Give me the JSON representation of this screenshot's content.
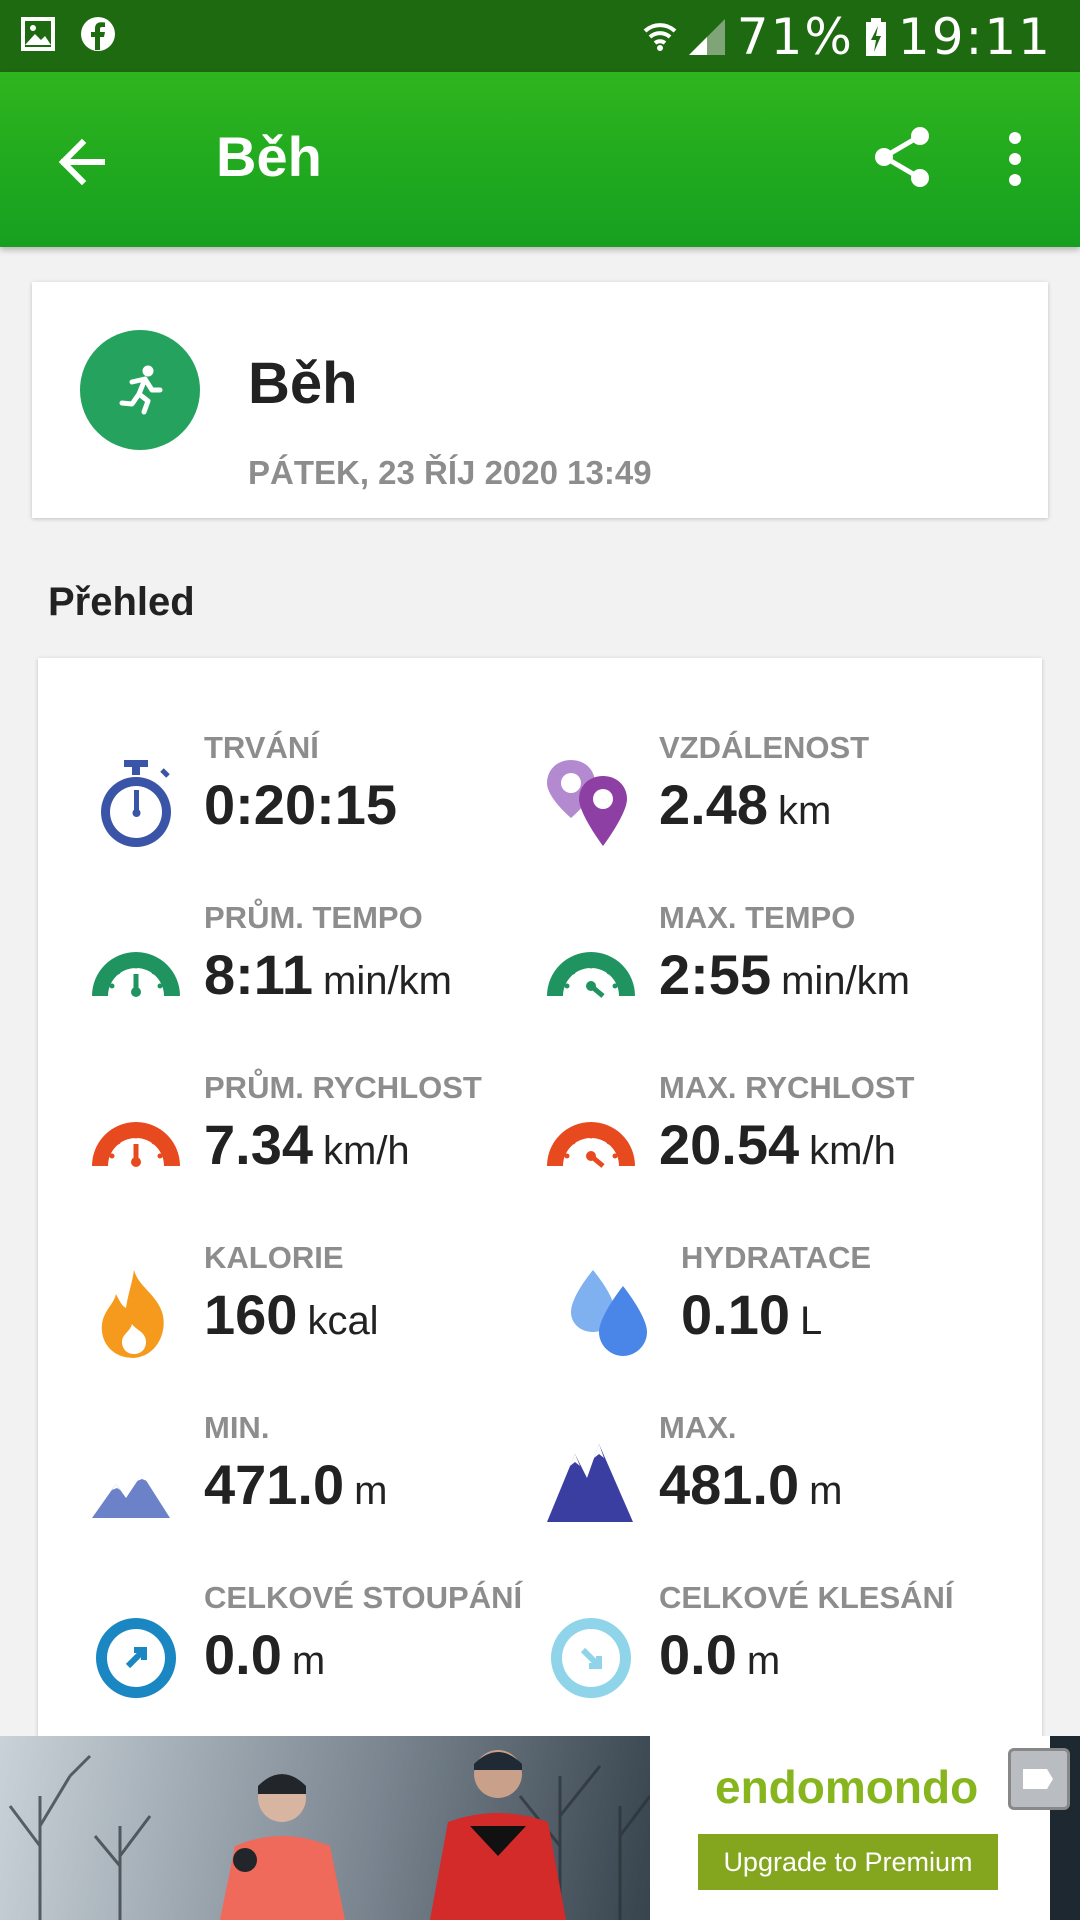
{
  "status_bar": {
    "battery": "71%",
    "time": "19:11"
  },
  "app_bar": {
    "title": "Běh"
  },
  "header": {
    "title": "Běh",
    "date": "PÁTEK, 23 ŘÍJ 2020 13:49"
  },
  "section": {
    "title": "Přehled"
  },
  "stats": [
    {
      "label": "TRVÁNÍ",
      "value": "0:20:15",
      "unit": "",
      "icon": "stopwatch-icon"
    },
    {
      "label": "VZDÁLENOST",
      "value": "2.48",
      "unit": "km",
      "icon": "location-pins-icon"
    },
    {
      "label": "PRŮM. TEMPO",
      "value": "8:11",
      "unit": "min/km",
      "icon": "avg-pace-gauge-icon"
    },
    {
      "label": "MAX. TEMPO",
      "value": "2:55",
      "unit": "min/km",
      "icon": "max-pace-gauge-icon"
    },
    {
      "label": "PRŮM. RYCHLOST",
      "value": "7.34",
      "unit": "km/h",
      "icon": "avg-speed-gauge-icon"
    },
    {
      "label": "MAX. RYCHLOST",
      "value": "20.54",
      "unit": "km/h",
      "icon": "max-speed-gauge-icon"
    },
    {
      "label": "KALORIE",
      "value": "160",
      "unit": "kcal",
      "icon": "flame-icon"
    },
    {
      "label": "HYDRATACE",
      "value": "0.10",
      "unit": "L",
      "icon": "water-drops-icon"
    },
    {
      "label": "MIN.",
      "value": "471.0",
      "unit": "m",
      "icon": "min-altitude-mountains-icon"
    },
    {
      "label": "MAX.",
      "value": "481.0",
      "unit": "m",
      "icon": "max-altitude-mountains-icon"
    },
    {
      "label": "CELKOVÉ STOUPÁNÍ",
      "value": "0.0",
      "unit": "m",
      "icon": "ascent-arrow-icon"
    },
    {
      "label": "CELKOVÉ KLESÁNÍ",
      "value": "0.0",
      "unit": "m",
      "icon": "descent-arrow-icon"
    }
  ],
  "ad": {
    "logo": "endomondo",
    "button": "Upgrade to Premium"
  },
  "colors": {
    "appbar_green": "#1fa51e",
    "status_green": "#1e6a10",
    "run_green": "#25a35e",
    "ad_button": "#84a51e"
  }
}
